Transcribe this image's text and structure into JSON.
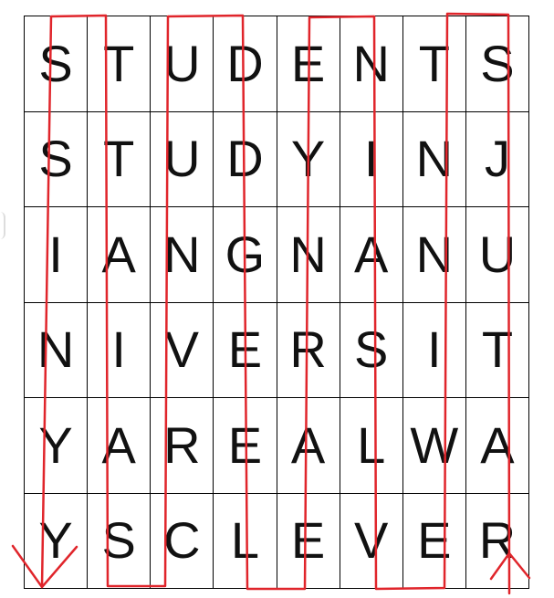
{
  "puzzle": {
    "rows": [
      [
        "S",
        "T",
        "U",
        "D",
        "E",
        "N",
        "T",
        "S"
      ],
      [
        "S",
        "T",
        "U",
        "D",
        "Y",
        "I",
        "N",
        "J"
      ],
      [
        "I",
        "A",
        "N",
        "G",
        "N",
        "A",
        "N",
        "U"
      ],
      [
        "N",
        "I",
        "V",
        "E",
        "R",
        "S",
        "I",
        "T"
      ],
      [
        "Y",
        "A",
        "R",
        "E",
        "A",
        "L",
        "W",
        "A"
      ],
      [
        "Y",
        "S",
        "C",
        "L",
        "E",
        "V",
        "E",
        "R"
      ]
    ]
  },
  "path": {
    "color": "#e0252b"
  }
}
